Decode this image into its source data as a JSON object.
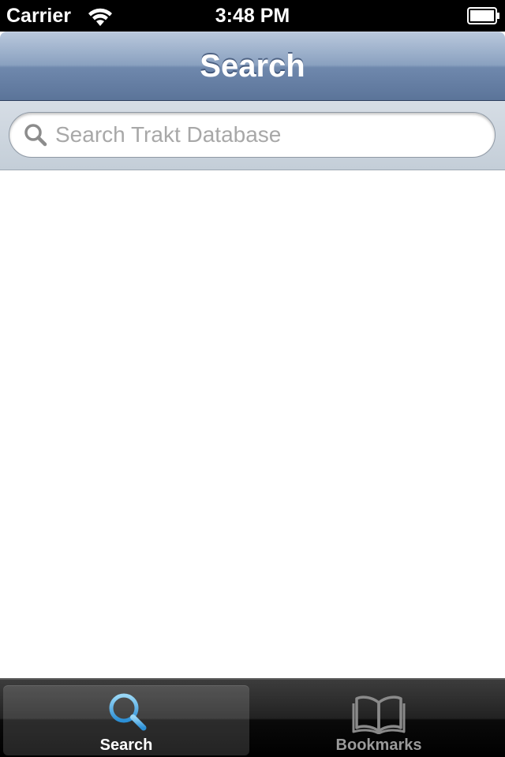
{
  "status_bar": {
    "carrier": "Carrier",
    "time": "3:48 PM",
    "wifi_icon": "wifi-icon",
    "battery_icon": "battery-icon"
  },
  "nav_bar": {
    "title": "Search",
    "color": "#6f88ad"
  },
  "search": {
    "placeholder": "Search Trakt Database",
    "value": "",
    "icon": "search-icon"
  },
  "tab_bar": {
    "tabs": [
      {
        "label": "Search",
        "icon": "magnifier-icon",
        "selected": true,
        "accent": "#4fb6ea"
      },
      {
        "label": "Bookmarks",
        "icon": "book-icon",
        "selected": false
      }
    ]
  }
}
